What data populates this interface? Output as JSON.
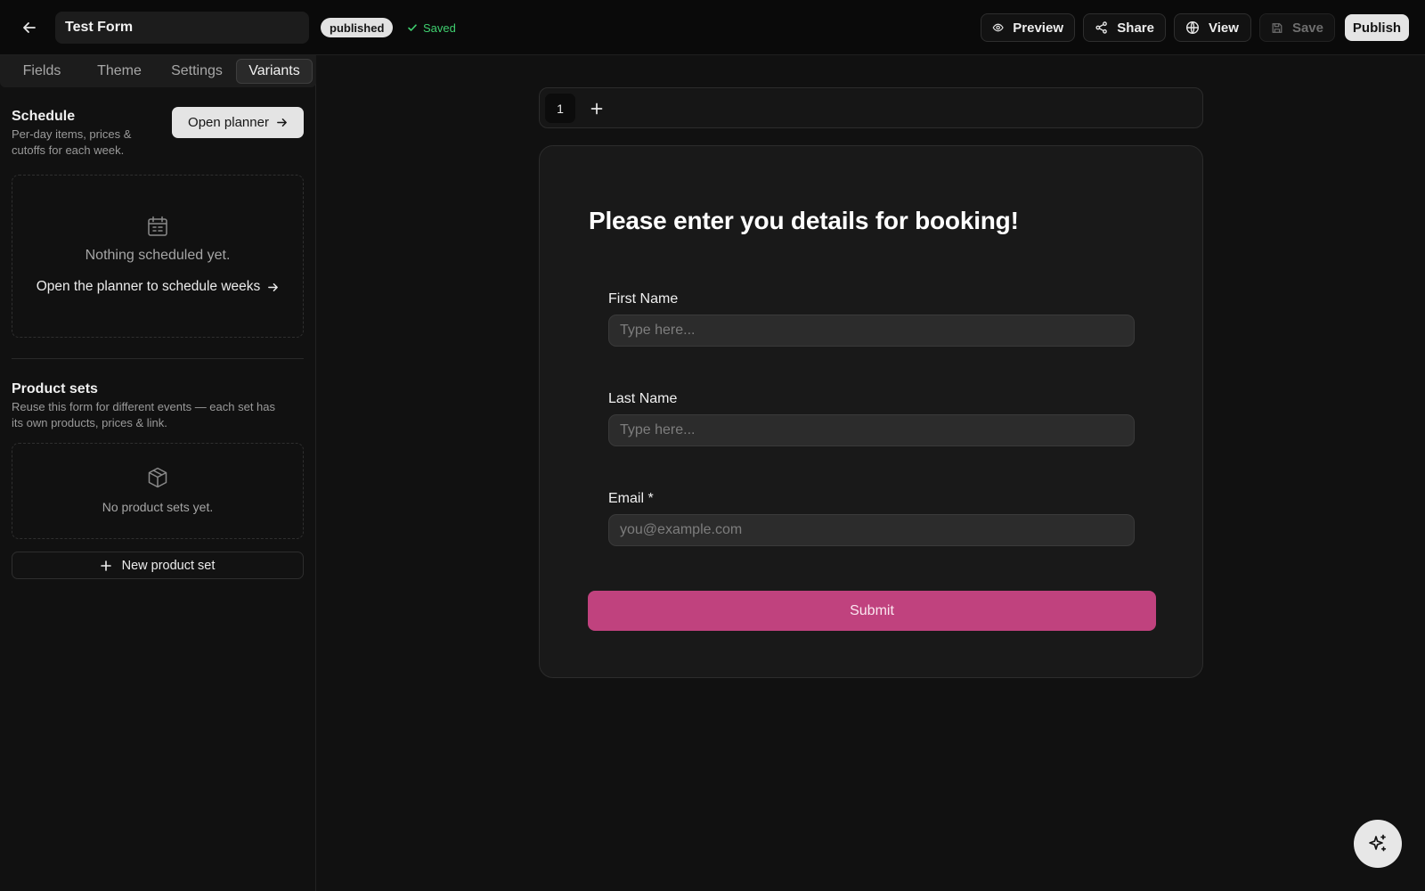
{
  "header": {
    "form_title": "Test Form",
    "status_badge": "published",
    "save_status": "Saved",
    "buttons": {
      "preview": "Preview",
      "share": "Share",
      "view": "View",
      "save": "Save",
      "publish": "Publish"
    }
  },
  "sidebar": {
    "tabs": [
      {
        "label": "Fields",
        "active": false
      },
      {
        "label": "Theme",
        "active": false
      },
      {
        "label": "Settings",
        "active": false
      },
      {
        "label": "Variants",
        "active": true
      }
    ],
    "schedule": {
      "title": "Schedule",
      "description_line1": "Per-day items, prices &",
      "description_line2": "cutoffs for each week.",
      "open_planner_label": "Open planner",
      "empty_text": "Nothing scheduled yet.",
      "planner_link_label": "Open the planner to schedule weeks"
    },
    "product_sets": {
      "title": "Product sets",
      "description_line1": "Reuse this form for different events — each set has",
      "description_line2": "its own products, prices & link.",
      "empty_text": "No product sets yet.",
      "new_button_label": "New product set"
    }
  },
  "canvas": {
    "pages": [
      "1"
    ],
    "form": {
      "heading": "Please enter you details for booking!",
      "fields": [
        {
          "label": "First Name",
          "placeholder": "Type here..."
        },
        {
          "label": "Last Name",
          "placeholder": "Type here..."
        },
        {
          "label": "Email *",
          "placeholder": "you@example.com"
        }
      ],
      "submit_label": "Submit"
    }
  },
  "colors": {
    "background": "#111111",
    "accent_submit": "#c0427e",
    "saved_green": "#3fcf6f"
  },
  "icons": {
    "back": "arrow-left-icon",
    "saved": "check-icon",
    "preview": "eye-icon",
    "share": "share-icon",
    "view": "globe-icon",
    "save": "floppy-disk-icon",
    "schedule_empty": "calendar-icon",
    "product_sets_empty": "box-icon",
    "add": "plus-icon",
    "ai_fab": "sparkles-icon"
  }
}
